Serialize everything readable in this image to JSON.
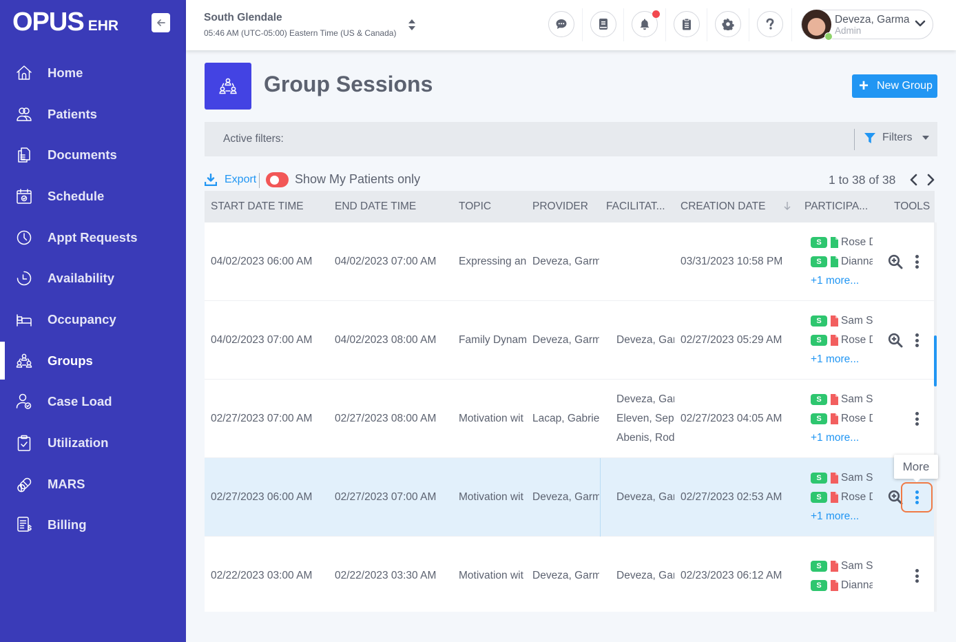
{
  "app": {
    "logo_main": "OPUS",
    "logo_sub": "EHR"
  },
  "sidebar": {
    "items": [
      {
        "label": "Home",
        "icon": "home-icon",
        "active": false
      },
      {
        "label": "Patients",
        "icon": "patients-icon",
        "active": false
      },
      {
        "label": "Documents",
        "icon": "documents-icon",
        "active": false
      },
      {
        "label": "Schedule",
        "icon": "calendar-icon",
        "active": false
      },
      {
        "label": "Appt Requests",
        "icon": "clock-icon",
        "active": false
      },
      {
        "label": "Availability",
        "icon": "availability-clock-icon",
        "active": false
      },
      {
        "label": "Occupancy",
        "icon": "bed-icon",
        "active": false
      },
      {
        "label": "Groups",
        "icon": "groups-icon",
        "active": true
      },
      {
        "label": "Case Load",
        "icon": "case-load-icon",
        "active": false
      },
      {
        "label": "Utilization",
        "icon": "clipboard-check-icon",
        "active": false
      },
      {
        "label": "MARS",
        "icon": "pills-icon",
        "active": false
      },
      {
        "label": "Billing",
        "icon": "billing-icon",
        "active": false
      }
    ]
  },
  "header": {
    "location": "South Glendale",
    "time": "05:46 AM (UTC-05:00) Eastern Time (US & Canada)",
    "icons": [
      "chat-icon",
      "book-icon",
      "bell-icon",
      "clipboard-icon",
      "gear-icon",
      "help-icon"
    ],
    "notification_dot": true,
    "user": {
      "name": "Deveza, Garma",
      "role": "Admin",
      "status": "online"
    }
  },
  "page": {
    "title": "Group Sessions",
    "new_button": "New Group",
    "active_filters_label": "Active filters:",
    "filters_button": "Filters",
    "export_label": "Export",
    "toggle_label": "Show My Patients only",
    "toggle_on": false,
    "paging": "1 to 38 of 38"
  },
  "colors": {
    "sidebar": "#3a3bb8",
    "primary": "#2196f3",
    "page_icon": "#4343e3",
    "toggle": "#f25757",
    "badge_green": "#2ec66f",
    "doc_green": "#2ec66f",
    "doc_red": "#f25f5f",
    "highlight_row": "#e2f0fb",
    "focus_ring": "#f07a45"
  },
  "table": {
    "columns": [
      "START DATE TIME",
      "END DATE TIME",
      "TOPIC",
      "PROVIDER",
      "FACILITAT...",
      "CREATION DATE",
      "PARTICIPA...",
      "TOOLS"
    ],
    "sorted_column": "CREATION DATE",
    "sort_direction": "desc",
    "rows": [
      {
        "start": "04/02/2023 06:00 AM",
        "end": "04/02/2023 07:00 AM",
        "topic": "Expressing an",
        "provider": "Deveza, Garm",
        "facilitators": [],
        "created": "03/31/2023 10:58 PM",
        "participants": [
          {
            "badge": "S",
            "doc": "green",
            "name": "Rose D"
          },
          {
            "badge": "S",
            "doc": "green",
            "name": "Dianna"
          }
        ],
        "more": "+1 more...",
        "has_zoom": true,
        "highlighted": false
      },
      {
        "start": "04/02/2023 07:00 AM",
        "end": "04/02/2023 08:00 AM",
        "topic": "Family Dynam",
        "provider": "Deveza, Garm",
        "facilitators": [
          "Deveza, Gar"
        ],
        "created": "02/27/2023 05:29 AM",
        "participants": [
          {
            "badge": "S",
            "doc": "red",
            "name": "Sam S"
          },
          {
            "badge": "S",
            "doc": "red",
            "name": "Rose D"
          }
        ],
        "more": "+1 more...",
        "has_zoom": true,
        "highlighted": false
      },
      {
        "start": "02/27/2023 07:00 AM",
        "end": "02/27/2023 08:00 AM",
        "topic": "Motivation wit",
        "provider": "Lacap, Gabriel",
        "facilitators": [
          "Deveza, Gar",
          "Eleven, Sept",
          "Abenis, Rod"
        ],
        "created": "02/27/2023 04:05 AM",
        "participants": [
          {
            "badge": "S",
            "doc": "red",
            "name": "Sam S"
          },
          {
            "badge": "S",
            "doc": "red",
            "name": "Rose D"
          }
        ],
        "more": "+1 more...",
        "has_zoom": false,
        "highlighted": false
      },
      {
        "start": "02/27/2023 06:00 AM",
        "end": "02/27/2023 07:00 AM",
        "topic": "Motivation wit",
        "provider": "Deveza, Garm",
        "facilitators": [
          "Deveza, Gar"
        ],
        "created": "02/27/2023 02:53 AM",
        "participants": [
          {
            "badge": "S",
            "doc": "red",
            "name": "Sam S"
          },
          {
            "badge": "S",
            "doc": "red",
            "name": "Rose D"
          }
        ],
        "more": "+1 more...",
        "has_zoom": true,
        "highlighted": true
      },
      {
        "start": "02/22/2023 03:00 AM",
        "end": "02/22/2023 03:30 AM",
        "topic": "Motivation wit",
        "provider": "Deveza, Garm",
        "facilitators": [
          "Deveza, Gar"
        ],
        "created": "02/23/2023 06:12 AM",
        "participants": [
          {
            "badge": "S",
            "doc": "red",
            "name": "Sam S"
          },
          {
            "badge": "S",
            "doc": "red",
            "name": "Dianna"
          }
        ],
        "more": "",
        "has_zoom": false,
        "highlighted": false
      }
    ]
  },
  "tooltip": {
    "text": "More"
  }
}
